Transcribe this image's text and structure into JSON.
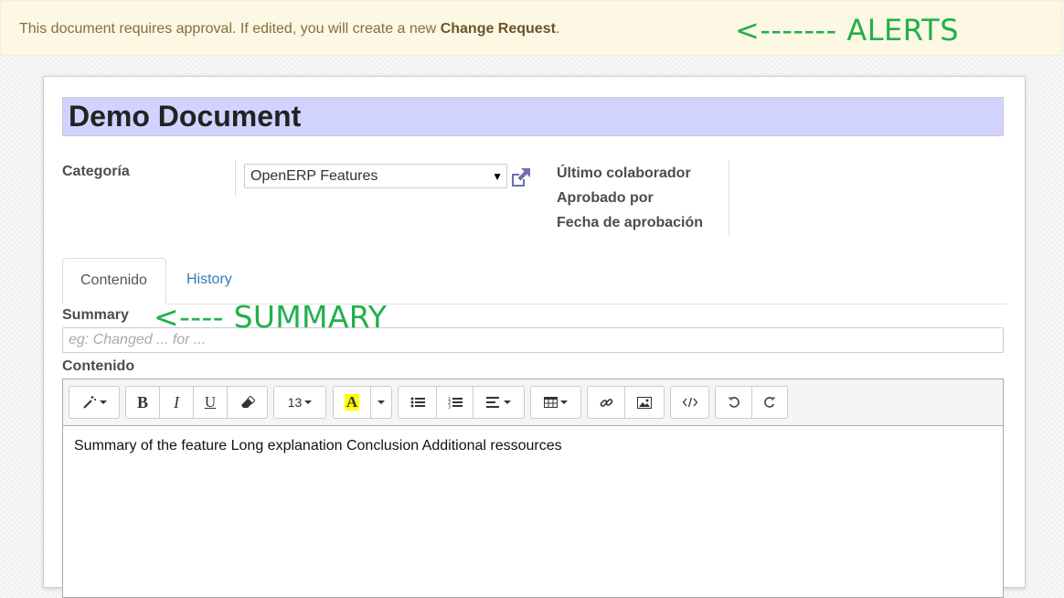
{
  "alert": {
    "text_prefix": "This document requires approval. If edited, you will create a new ",
    "text_bold": "Change Request",
    "text_suffix": "."
  },
  "annotations": {
    "alerts": "<-------   ALERTS",
    "summary": "<---- SUMMARY"
  },
  "document": {
    "title": "Demo Document"
  },
  "fields": {
    "category_label": "Categoría",
    "category_value": "OpenERP Features",
    "last_contributor_label": "Último colaborador",
    "approved_by_label": "Aprobado por",
    "approval_date_label": "Fecha de aprobación"
  },
  "tabs": [
    {
      "label": "Contenido",
      "active": true
    },
    {
      "label": "History",
      "active": false
    }
  ],
  "summary": {
    "label": "Summary",
    "placeholder": "eg: Changed ... for ..."
  },
  "content": {
    "label": "Contenido",
    "body": "Summary of the feature Long explanation Conclusion Additional ressources"
  },
  "toolbar": {
    "font_size": "13",
    "bold": "B",
    "italic": "I",
    "underline": "U",
    "color_letter": "A",
    "icons": [
      "magic-wand-icon",
      "eraser-icon",
      "unordered-list-icon",
      "ordered-list-icon",
      "align-icon",
      "table-icon",
      "link-icon",
      "picture-icon",
      "code-view-icon",
      "undo-icon",
      "redo-icon"
    ]
  },
  "colors": {
    "alert_bg": "#fcf8e3",
    "title_bg": "#d2d2ff",
    "annotation": "#22b04b",
    "link": "#337ab7",
    "highlight": "#ffff00"
  }
}
